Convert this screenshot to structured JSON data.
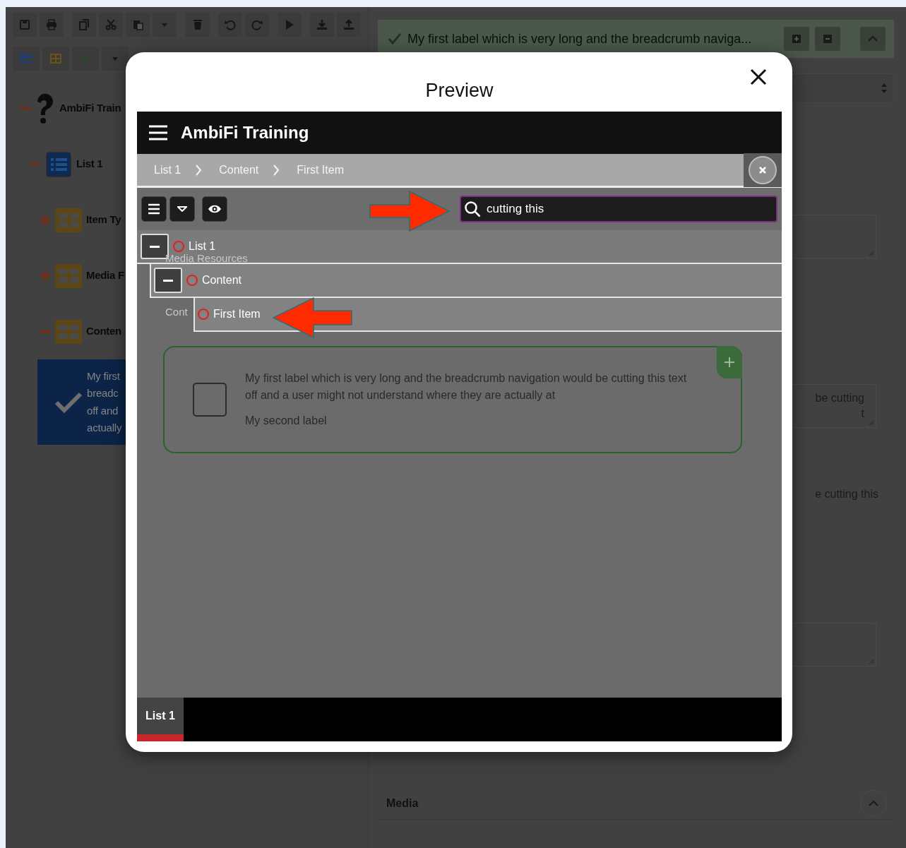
{
  "editor_tree": [
    {
      "label": "AmbiFi Train",
      "kind": "root",
      "expanded": true
    },
    {
      "label": "List 1",
      "kind": "list",
      "expanded": true
    },
    {
      "label": "Item Ty",
      "kind": "group",
      "expanded": false
    },
    {
      "label": "Media F",
      "kind": "group",
      "expanded": false
    },
    {
      "label": "Conten",
      "kind": "group",
      "expanded": true
    }
  ],
  "selected_item": {
    "checked": true,
    "lines": [
      "My first",
      "breadc",
      "off and",
      "actually"
    ]
  },
  "item_header": {
    "done": true,
    "title": "My first label which is very long and the breadcrumb naviga..."
  },
  "fields": [
    {
      "kind": "textarea"
    },
    {
      "kind": "textarea",
      "lines": [
        "be cutting",
        "t"
      ]
    },
    {
      "kind": "text",
      "lines": [
        "e cutting this"
      ]
    },
    {
      "kind": "textarea"
    }
  ],
  "section": {
    "title": "Media",
    "expanded": true
  },
  "modal": {
    "title": "Preview",
    "app_title": "AmbiFi Training",
    "breadcrumb": [
      "List 1",
      "Content",
      "First Item"
    ],
    "search": {
      "value": "cutting this"
    },
    "tree": [
      {
        "label": "List 1",
        "expanded": true,
        "children": [
          {
            "label": "Content",
            "expanded": true,
            "children": [
              {
                "label": "First Item"
              }
            ]
          }
        ]
      }
    ],
    "ghost_labels": [
      "Media Resources",
      "Cont"
    ],
    "card": {
      "checked": false,
      "label": "My first label which is very long and the breadcrumb navigation would be cutting this text off and a user might not understand where they are actually at",
      "second_label": "My second label"
    },
    "bottom_tabs": [
      {
        "label": "List 1",
        "selected": true
      }
    ]
  }
}
